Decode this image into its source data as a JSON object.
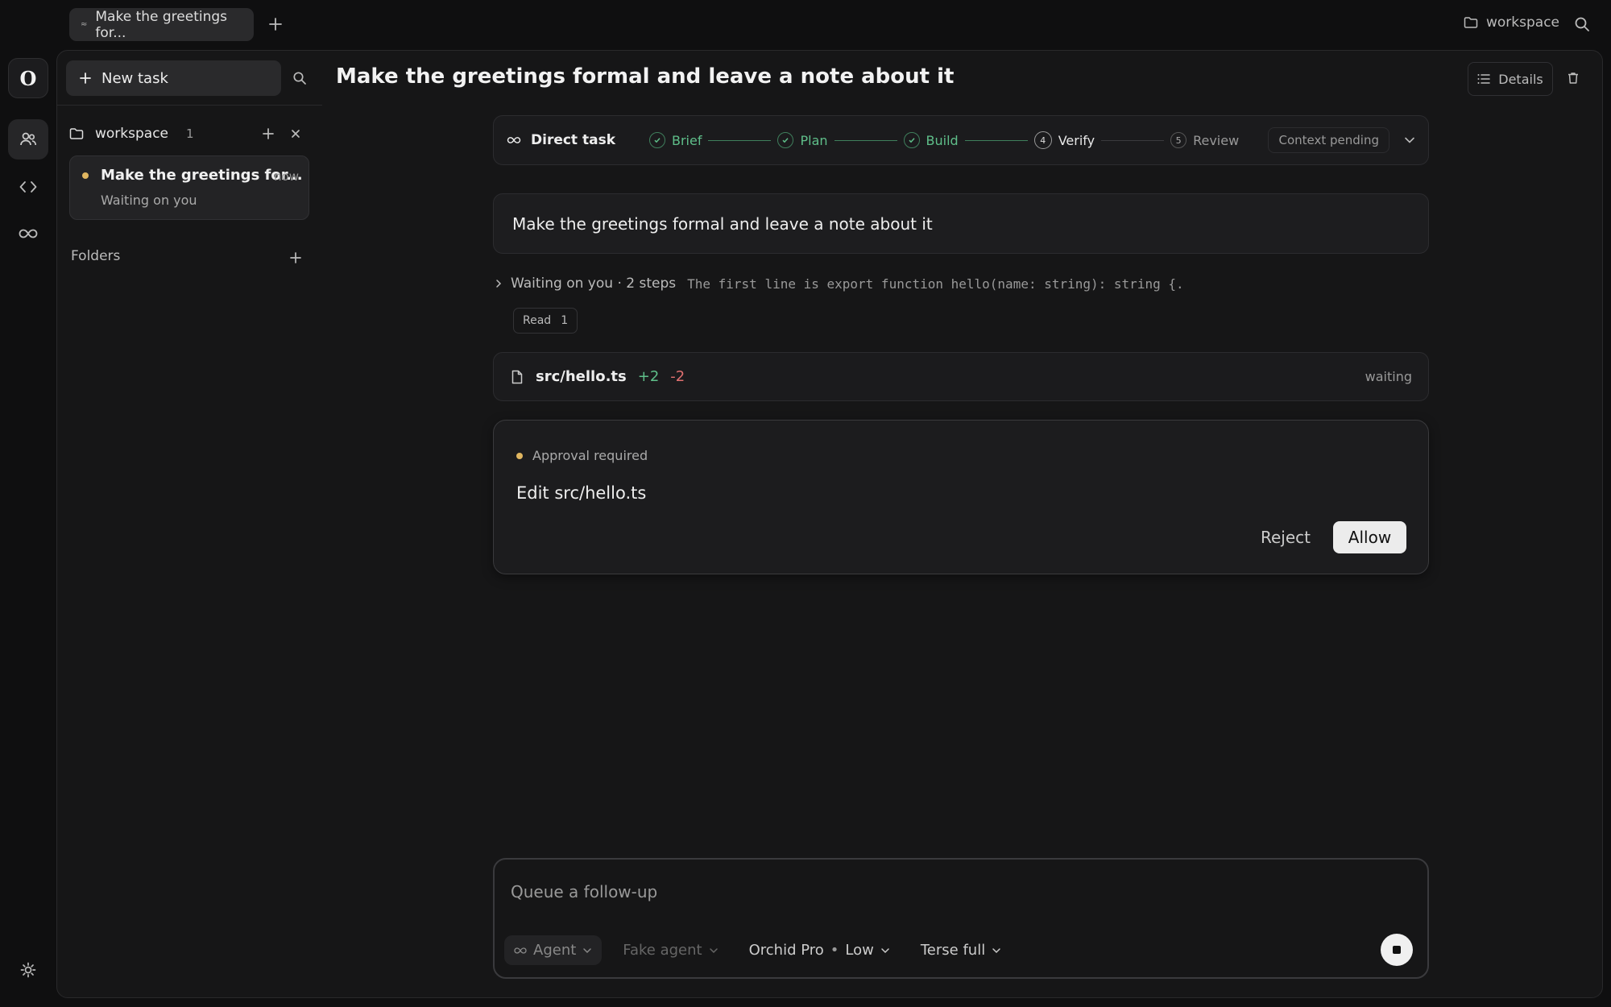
{
  "tabs": [
    {
      "label": "Make the greetings for..."
    }
  ],
  "top": {
    "workspace_label": "workspace"
  },
  "sidebar": {
    "new_task_label": "New task",
    "workspace": {
      "name": "workspace",
      "count": "1"
    },
    "tasks": [
      {
        "title": "Make the greetings for...",
        "time": "now",
        "status": "Waiting on you"
      }
    ],
    "folders_label": "Folders"
  },
  "header": {
    "title": "Make the greetings formal and leave a note about it",
    "details_label": "Details"
  },
  "stepper": {
    "label": "Direct task",
    "steps": [
      {
        "num": "1",
        "label": "Brief",
        "state": "done"
      },
      {
        "num": "2",
        "label": "Plan",
        "state": "done"
      },
      {
        "num": "3",
        "label": "Build",
        "state": "done"
      },
      {
        "num": "4",
        "label": "Verify",
        "state": "current"
      },
      {
        "num": "5",
        "label": "Review",
        "state": "todo"
      }
    ],
    "context_label": "Context pending"
  },
  "message": "Make the greetings formal and leave a note about it",
  "activity": {
    "summary": "Waiting on you · 2 steps",
    "detail": "The first line is export function hello(name: string): string {.",
    "read_label": "Read",
    "read_count": "1"
  },
  "file": {
    "name": "src/hello.ts",
    "added": "+2",
    "removed": "-2",
    "status": "waiting"
  },
  "approval": {
    "header": "Approval required",
    "action": "Edit src/hello.ts",
    "reject_label": "Reject",
    "allow_label": "Allow"
  },
  "composer": {
    "placeholder": "Queue a follow-up",
    "agent_label": "Agent",
    "fake_agent_label": "Fake agent",
    "model_label": "Orchid Pro",
    "effort_label": "Low",
    "mode_label": "Terse full"
  },
  "colors": {
    "success": "#5fbf8a",
    "danger": "#e07070",
    "pending": "#e0b660"
  }
}
